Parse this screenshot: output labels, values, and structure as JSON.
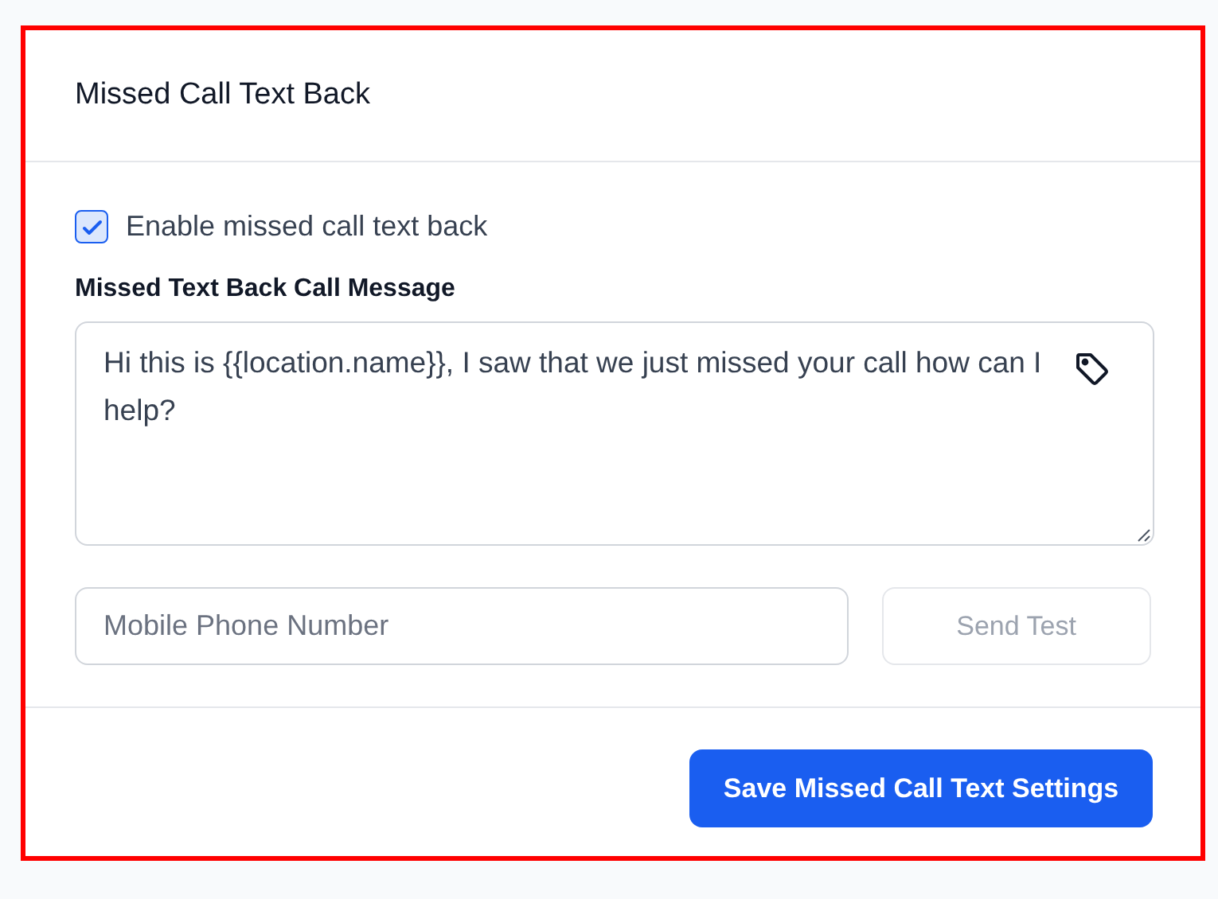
{
  "title": "Missed Call Text Back",
  "enable": {
    "label": "Enable missed call text back",
    "checked": true
  },
  "message": {
    "label": "Missed Text Back Call Message",
    "value": "Hi this is {{location.name}}, I saw that we just missed your call how can I help?"
  },
  "phone": {
    "placeholder": "Mobile Phone Number"
  },
  "send_test": {
    "label": "Send Test",
    "disabled": true
  },
  "save": {
    "label": "Save Missed Call Text Settings"
  }
}
